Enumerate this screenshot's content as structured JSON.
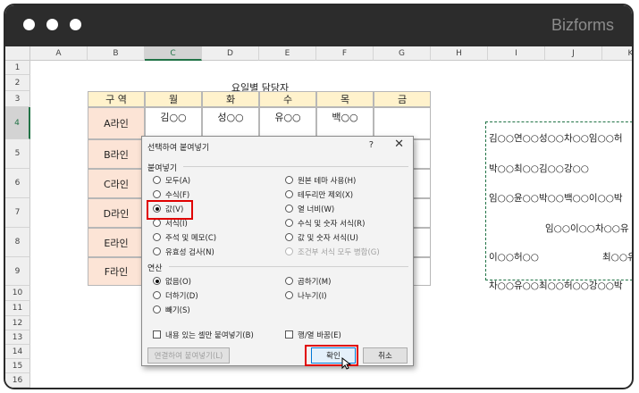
{
  "brand": "Bizforms",
  "columns": [
    "A",
    "B",
    "C",
    "D",
    "E",
    "F",
    "G",
    "H",
    "I",
    "J",
    "K"
  ],
  "rows": [
    "1",
    "2",
    "3",
    "4",
    "5",
    "6",
    "7",
    "8",
    "9",
    "10",
    "11",
    "12",
    "13",
    "14",
    "15",
    "16",
    "17"
  ],
  "sheet_title": "요일별 담당자",
  "table": {
    "corner": "구 역",
    "days": [
      "월",
      "화",
      "수",
      "목",
      "금"
    ],
    "regions": [
      "A라인",
      "B라인",
      "C라인",
      "D라인",
      "E라인",
      "F라인"
    ],
    "first_row": [
      "김○○",
      "성○○",
      "유○○",
      "백○○",
      ""
    ]
  },
  "right_cells": [
    "김○○연○○성○○차○○임○○허",
    "박○○최○○김○○강○○",
    "임○○윤○○박○○백○○이○○박",
    "임○○이○○차○○유",
    "이○○허○○",
    "최○○유",
    "차○○유○○최○○허○○강○○박"
  ],
  "dialog": {
    "title": "선택하여 붙여넣기",
    "help": "?",
    "close": "✕",
    "paste_section": "붙여넣기",
    "paste_left": [
      "모두(A)",
      "수식(F)",
      "값(V)",
      "서식(I)",
      "주석 및 메모(C)",
      "유효성 검사(N)"
    ],
    "paste_right": [
      "원본 테마 사용(H)",
      "테두리만 제외(X)",
      "열 너비(W)",
      "수식 및 숫자 서식(R)",
      "값 및 숫자 서식(U)",
      "조건부 서식 모두 병합(G)"
    ],
    "op_section": "연산",
    "op_left": [
      "없음(O)",
      "더하기(D)",
      "빼기(S)"
    ],
    "op_right": [
      "곱하기(M)",
      "나누기(I)"
    ],
    "skip_blanks": "내용 있는 셀만 붙여넣기(B)",
    "transpose": "행/열 바꿈(E)",
    "paste_link": "연결하여 붙여넣기(L)",
    "ok": "확인",
    "cancel": "취소"
  }
}
